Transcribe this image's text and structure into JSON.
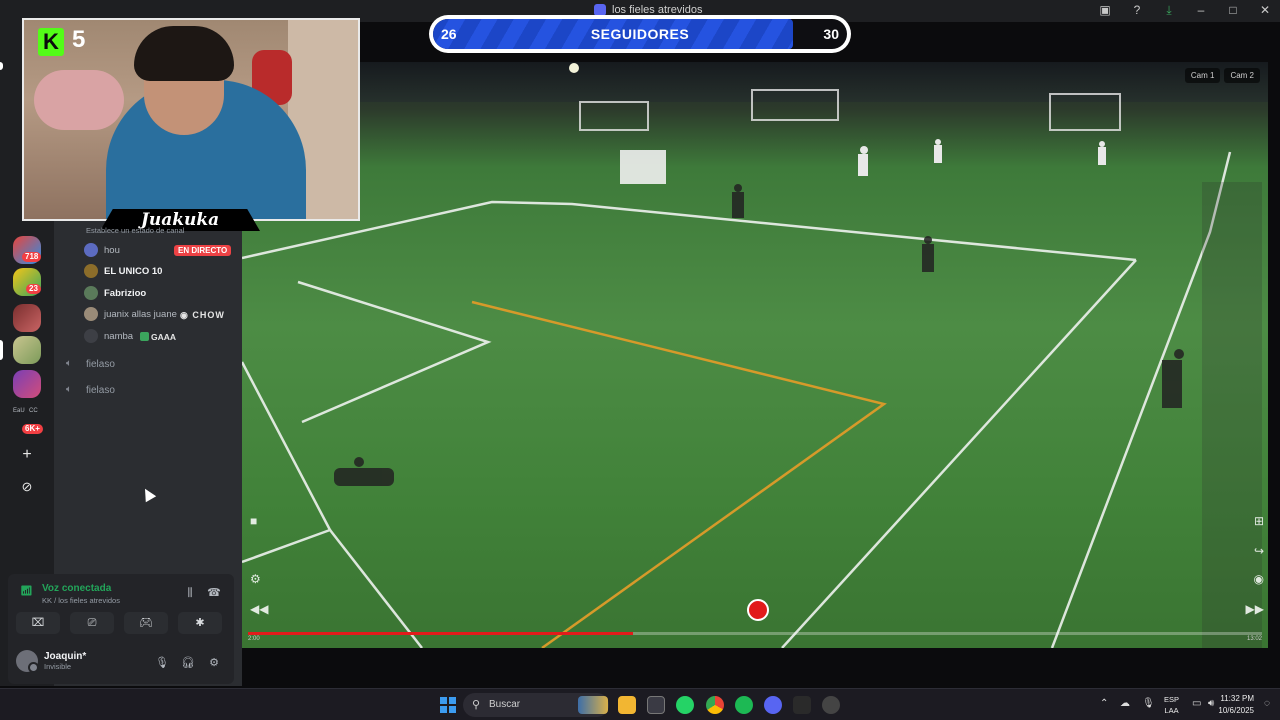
{
  "window": {
    "title": "los fieles atrevidos"
  },
  "titlebar_icons": [
    "inbox-icon",
    "help-icon",
    "download-icon",
    "minimize-icon",
    "maximize-icon",
    "close-icon"
  ],
  "webcam": {
    "badge_letter": "K",
    "badge_number": "5",
    "streamer_name": "Juakuka",
    "status_hint": "Establece un estado de canal"
  },
  "followers_goal": {
    "label": "SEGUIDORES",
    "current": "26",
    "target": "30",
    "progress": 0.87
  },
  "server_rail": {
    "badges": [
      "718",
      "23",
      "6K+"
    ],
    "tags": [
      "EaU",
      "CC"
    ]
  },
  "voice_members": [
    {
      "name": "hou",
      "live": "EN DIRECTO"
    },
    {
      "name": "EL UNICO 10"
    },
    {
      "name": "Fabrizioo"
    },
    {
      "name": "juanix allas juane",
      "status": "CHOW"
    },
    {
      "name": "namba",
      "status": "GAAA"
    }
  ],
  "voice_channels": [
    "fielaso",
    "fielaso"
  ],
  "voice_panel": {
    "status": "Voz conectada",
    "channel": "KK / los fieles atrevidos",
    "user_name": "Joaquin*",
    "user_status": "Invisible"
  },
  "video": {
    "camera_tabs": [
      "Cam 1",
      "Cam 2"
    ],
    "progress": 0.38,
    "time_elapsed": "2:00",
    "time_total": "13:02"
  },
  "taskbar": {
    "search_placeholder": "Buscar",
    "language": "ESP",
    "layout": "LAA",
    "time": "11:32 PM",
    "date": "10/6/2025"
  },
  "colors": {
    "accent_green": "#23a55a",
    "live_red": "#ed4245",
    "kick_green": "#53fc18",
    "goal_blue": "#2553e0"
  }
}
